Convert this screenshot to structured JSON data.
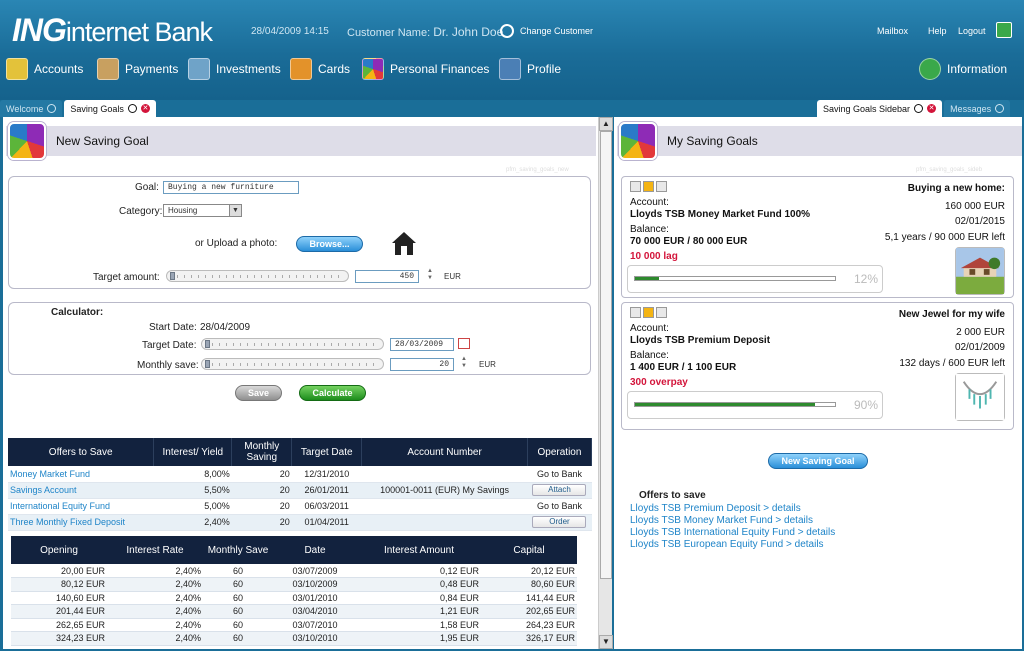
{
  "header": {
    "logo_brand": "ING",
    "logo_rest": "internet Bank",
    "datetime": "28/04/2009 14:15",
    "customer_label": "Customer Name:",
    "customer_name": "Dr. John Doe",
    "change_customer": "Change Customer",
    "links": [
      "Mailbox",
      "Help",
      "Logout"
    ]
  },
  "nav": {
    "items": [
      {
        "label": "Accounts",
        "icon": "accounts-icon",
        "color": "#e3c23a"
      },
      {
        "label": "Payments",
        "icon": "payments-icon",
        "color": "#c8a060"
      },
      {
        "label": "Investments",
        "icon": "investments-icon",
        "color": "#6fa3c8"
      },
      {
        "label": "Cards",
        "icon": "cards-icon",
        "color": "#e3922a"
      },
      {
        "label": "Personal Finances",
        "icon": "personal-finances-icon",
        "color": "#8e2bb6"
      },
      {
        "label": "Profile",
        "icon": "profile-icon",
        "color": "#4b7fb5"
      }
    ],
    "information": "Information"
  },
  "tabs_left": [
    {
      "label": "Welcome",
      "active": false
    },
    {
      "label": "Saving Goals",
      "active": true
    }
  ],
  "tabs_right": [
    {
      "label": "Saving Goals Sidebar",
      "active": true
    },
    {
      "label": "Messages",
      "active": false
    }
  ],
  "left": {
    "title": "New Saving Goal",
    "watermark": "pfm_saving_goals_new",
    "goal_label": "Goal:",
    "goal_value": "Buying a new furniture",
    "category_label": "Category:",
    "category_value": "Housing",
    "upload_label": "or Upload a photo:",
    "browse": "Browse...",
    "target_amount_label": "Target amount:",
    "target_amount_value": "450",
    "currency": "EUR",
    "calculator_label": "Calculator:",
    "start_date_label": "Start Date:",
    "start_date_value": "28/04/2009",
    "target_date_label": "Target Date:",
    "target_date_value": "28/03/2009",
    "monthly_save_label": "Monthly save:",
    "monthly_save_value": "20",
    "save_button": "Save",
    "calculate_button": "Calculate",
    "offers": {
      "headers": [
        "Offers to Save",
        "Interest/ Yield",
        "Monthly Saving",
        "Target Date",
        "Account Number",
        "Operation"
      ],
      "rows": [
        {
          "name": "Money Market Fund",
          "rate": "8,00%",
          "saving": "20",
          "date": "12/31/2010",
          "account": "",
          "op": "Go to Bank",
          "op_button": false
        },
        {
          "name": "Savings Account",
          "rate": "5,50%",
          "saving": "20",
          "date": "26/01/2011",
          "account": "100001-0011 (EUR) My Savings",
          "op": "Attach",
          "op_button": true
        },
        {
          "name": "International Equity Fund",
          "rate": "5,00%",
          "saving": "20",
          "date": "06/03/2011",
          "account": "",
          "op": "Go to Bank",
          "op_button": false
        },
        {
          "name": "Three Monthly Fixed Deposit",
          "rate": "2,40%",
          "saving": "20",
          "date": "01/04/2011",
          "account": "",
          "op": "Order",
          "op_button": true
        }
      ]
    },
    "calc_table": {
      "headers": [
        "Opening",
        "Interest Rate",
        "Monthly Save",
        "Date",
        "Interest Amount",
        "Capital"
      ],
      "rows": [
        [
          "20,00 EUR",
          "2,40%",
          "60",
          "03/07/2009",
          "0,12 EUR",
          "20,12 EUR"
        ],
        [
          "80,12 EUR",
          "2,40%",
          "60",
          "03/10/2009",
          "0,48 EUR",
          "80,60 EUR"
        ],
        [
          "140,60 EUR",
          "2,40%",
          "60",
          "03/01/2010",
          "0,84 EUR",
          "141,44 EUR"
        ],
        [
          "201,44 EUR",
          "2,40%",
          "60",
          "03/04/2010",
          "1,21 EUR",
          "202,65 EUR"
        ],
        [
          "262,65 EUR",
          "2,40%",
          "60",
          "03/07/2010",
          "1,58 EUR",
          "264,23 EUR"
        ],
        [
          "324,23 EUR",
          "2,40%",
          "60",
          "03/10/2010",
          "1,95 EUR",
          "326,17 EUR"
        ]
      ]
    }
  },
  "right": {
    "title": "My Saving Goals",
    "watermark": "pfm_saving_goals_sideb",
    "account_label": "Account:",
    "balance_label": "Balance:",
    "goals": [
      {
        "name": "Buying a new home:",
        "account": "Lloyds TSB Money Market Fund 100%",
        "balance": "70 000 EUR / 80 000 EUR",
        "status": "10 000 lag",
        "target": "160 000 EUR",
        "date": "02/01/2015",
        "left": "5,1 years / 90 000 EUR left",
        "progress": 12,
        "progress_label": "12%",
        "image": "house-photo"
      },
      {
        "name": "New Jewel for my wife",
        "account": "Lloyds TSB Premium Deposit",
        "balance": "1 400 EUR / 1 100 EUR",
        "status": "300 overpay",
        "target": "2 000 EUR",
        "date": "02/01/2009",
        "left": "132 days / 600 EUR left",
        "progress": 90,
        "progress_label": "90%",
        "image": "necklace-photo"
      }
    ],
    "new_goal_button": "New Saving Goal",
    "offers_title": "Offers to save",
    "offers_links": [
      "Lloyds TSB Premium Deposit > details",
      "Lloyds TSB Money Market Fund > details",
      "Lloyds TSB International Equity Fund > details",
      "Lloyds TSB European Equity Fund > details"
    ]
  },
  "colors": {
    "header_blue": "#1a6e98",
    "table_header": "#12223e",
    "link": "#1e84c8",
    "status_red": "#d3143a",
    "progress_green": "#2e8a2e"
  }
}
